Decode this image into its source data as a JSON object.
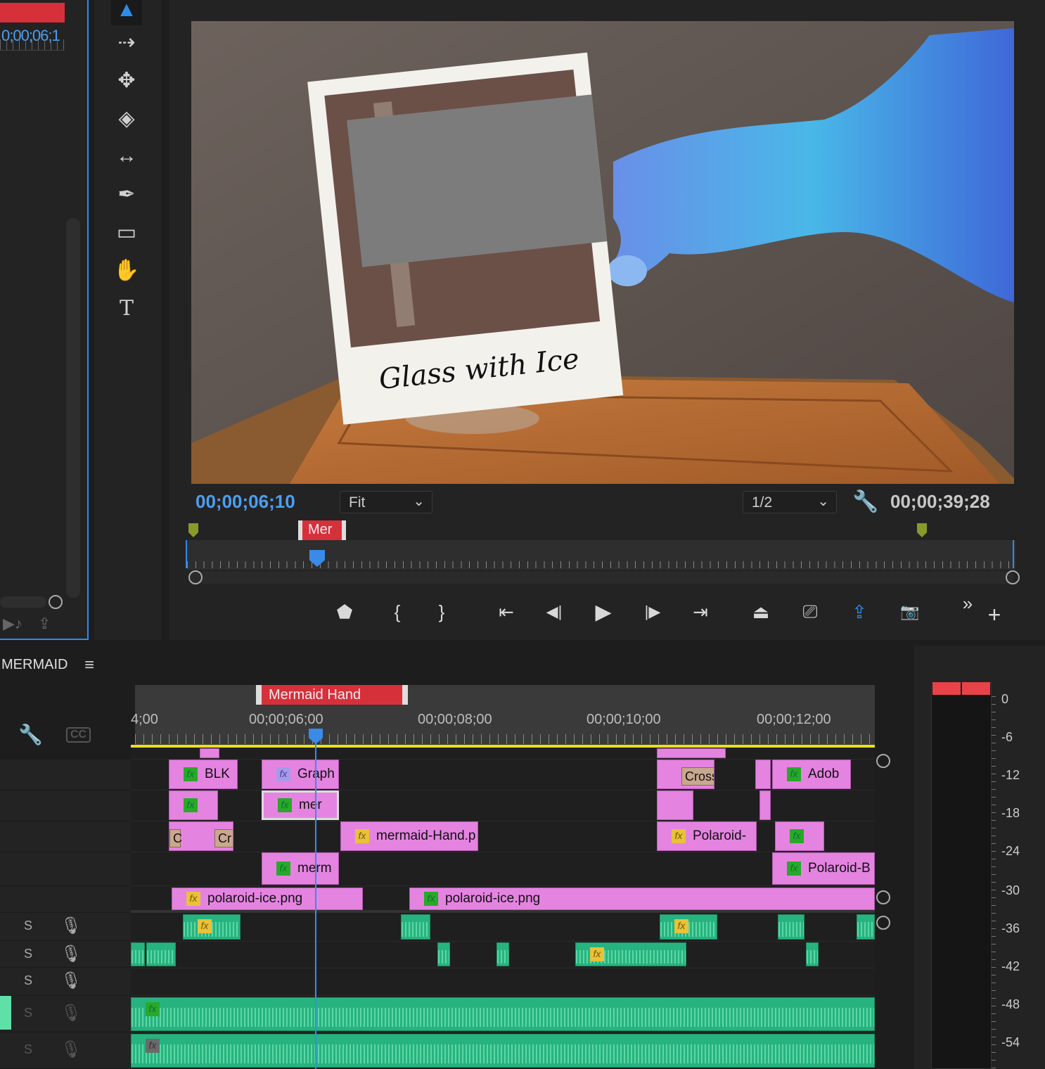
{
  "source_monitor": {
    "timecode": "0;00;06;1"
  },
  "tools": [
    {
      "name": "selection-tool-icon",
      "glyph": "▲"
    },
    {
      "name": "track-select-forward-icon",
      "glyph": "⇢"
    },
    {
      "name": "ripple-edit-icon",
      "glyph": "⟺"
    },
    {
      "name": "razor-icon",
      "glyph": "◆"
    },
    {
      "name": "slip-tool-icon",
      "glyph": "↔"
    },
    {
      "name": "pen-tool-icon",
      "glyph": "✒"
    },
    {
      "name": "rectangle-tool-icon",
      "glyph": "▭"
    },
    {
      "name": "hand-tool-icon",
      "glyph": "✋"
    },
    {
      "name": "type-tool-icon",
      "glyph": "T"
    }
  ],
  "program_monitor": {
    "current_time": "00;00;06;10",
    "zoom": "Fit",
    "resolution": "1/2",
    "duration": "00;00;39;28",
    "marker_label": "Mer",
    "polaroid_caption": "Glass with Ice"
  },
  "transport": {
    "marker": "⬟",
    "mark_in": "{",
    "mark_out": "}",
    "go_to_in": "⇤",
    "step_back": "◀|",
    "play": "▶",
    "step_forward": "|▶",
    "go_to_out": "⇥",
    "lift": "⏏",
    "extract": "⎚",
    "export": "⇪",
    "camera": "📷",
    "more": "»",
    "add": "+"
  },
  "timeline": {
    "sequence_name": "MERMAID",
    "menu_icon": "≡",
    "marker_label": "Mermaid Hand",
    "time_labels": [
      "4;00",
      "00;00;06;00",
      "00;00;08;00",
      "00;00;10;00",
      "00;00;12;00"
    ],
    "cc_label": "CC",
    "audio_s": "S",
    "clips": {
      "blk": "BLK",
      "graph": "Graph",
      "mer": "mer",
      "merm": "merm",
      "mermaid_hand": "mermaid-Hand.p",
      "polaroid1": "Polaroid-",
      "polaroid_b": "Polaroid-B",
      "adob": "Adob",
      "cross": "Cross",
      "polaroid_ice_1": "polaroid-ice.png",
      "polaroid_ice_2": "polaroid-ice.png",
      "c": "C",
      "cr": "Cr"
    },
    "fx_label": "fx"
  },
  "audio_meter": {
    "labels": [
      "0",
      "-6",
      "-12",
      "-18",
      "-24",
      "-30",
      "-36",
      "-42",
      "-48",
      "-54"
    ],
    "peak_color": "#e84348"
  }
}
